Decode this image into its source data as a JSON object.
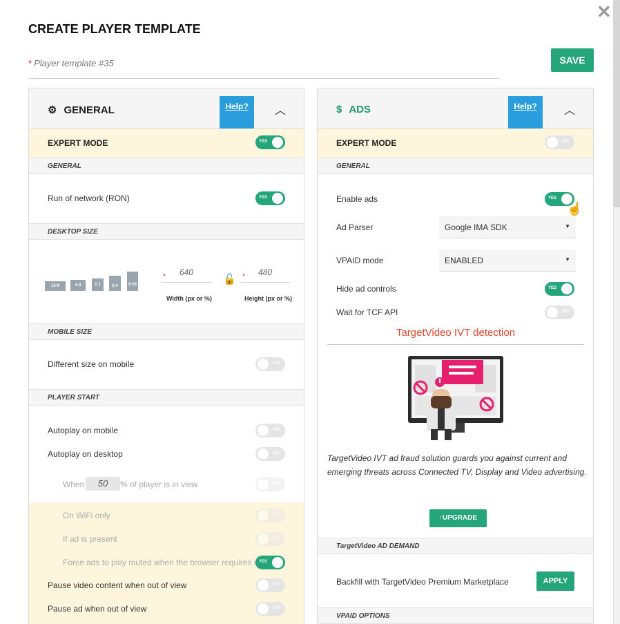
{
  "modal": {
    "title": "CREATE PLAYER TEMPLATE",
    "name_placeholder": "Player template #35",
    "name_required_mark": "*",
    "save_label": "SAVE",
    "close_glyph": "✕"
  },
  "left": {
    "title": "GENERAL",
    "icon": "gear-icon",
    "help_label": "Help?",
    "expert_label": "EXPERT MODE",
    "expert_state": "YES",
    "section_general": "GENERAL",
    "ron_label": "Run of network (RON)",
    "ron_state": "YES",
    "section_desktop": "DESKTOP SIZE",
    "ratios": [
      "16:9",
      "4:3",
      "1:1",
      "3:4",
      "9:16"
    ],
    "width_value": "640",
    "height_value": "480",
    "width_caption": "Width (px or %)",
    "height_caption": "Height (px or %)",
    "section_mobile": "MOBILE SIZE",
    "mobile_label": "Different size on mobile",
    "section_start": "PLAYER START",
    "autoplay_mobile": "Autoplay on mobile",
    "autoplay_desktop": "Autoplay on desktop",
    "when_prefix": "When",
    "when_value": "50",
    "when_suffix": "% of player is in view",
    "wifi_only": "On WiFi only",
    "ad_present": "If ad is present",
    "force_muted": "Force ads to play muted when the browser requires it",
    "pause_video": "Pause video content when out of view",
    "pause_ad": "Pause ad when out of view",
    "no_label": "NO",
    "yes_label": "YES"
  },
  "right": {
    "title": "ADS",
    "icon": "dollar-icon",
    "help_label": "Help?",
    "expert_label": "EXPERT MODE",
    "section_general": "GENERAL",
    "enable_ads": "Enable ads",
    "ad_parser_label": "Ad Parser",
    "ad_parser_value": "Google IMA SDK",
    "vpaid_label": "VPAID mode",
    "vpaid_value": "ENABLED",
    "hide_controls": "Hide ad controls",
    "wait_tcf": "Wait for TCF API",
    "ivt_title": "TargetVideo IVT detection",
    "ivt_text": "TargetVideo IVT ad fraud solution guards you against current and emerging threats across Connected TV, Display and Video advertising.",
    "upgrade_label": "UPGRADE",
    "section_demand": "TargetVideo AD DEMAND",
    "backfill_label": "Backfill with TargetVideo Premium Marketplace",
    "apply_label": "APPLY",
    "section_vpaid": "VPAID OPTIONS"
  }
}
